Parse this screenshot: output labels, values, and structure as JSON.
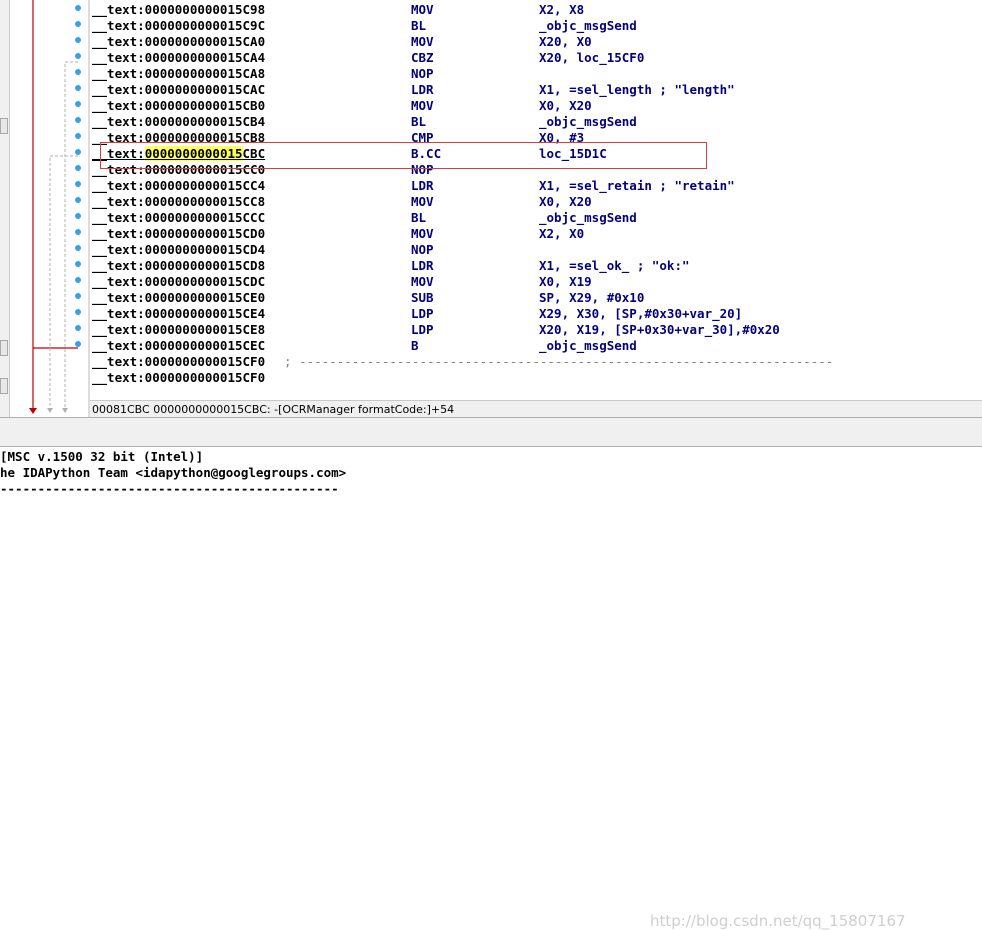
{
  "listing": {
    "rows": [
      {
        "addr": "__text:0000000000015C98",
        "mn": "MOV",
        "ops": "X2, X8"
      },
      {
        "addr": "__text:0000000000015C9C",
        "mn": "BL",
        "ops": "_objc_msgSend"
      },
      {
        "addr": "__text:0000000000015CA0",
        "mn": "MOV",
        "ops": "X20, X0"
      },
      {
        "addr": "__text:0000000000015CA4",
        "mn": "CBZ",
        "ops": "X20, loc_15CF0"
      },
      {
        "addr": "__text:0000000000015CA8",
        "mn": "NOP",
        "ops": ""
      },
      {
        "addr": "__text:0000000000015CAC",
        "mn": "LDR",
        "ops": "X1, =sel_length ; \"length\""
      },
      {
        "addr": "__text:0000000000015CB0",
        "mn": "MOV",
        "ops": "X0, X20"
      },
      {
        "addr": "__text:0000000000015CB4",
        "mn": "BL",
        "ops": "_objc_msgSend"
      },
      {
        "addr": "__text:0000000000015CB8",
        "mn": "CMP",
        "ops": "X0, #3"
      },
      {
        "addr": "__text:0000000000015CBC",
        "mn": "B.CC",
        "ops": "loc_15D1C"
      },
      {
        "addr": "__text:0000000000015CC0",
        "mn": "NOP",
        "ops": ""
      },
      {
        "addr": "__text:0000000000015CC4",
        "mn": "LDR",
        "ops": "X1, =sel_retain ; \"retain\""
      },
      {
        "addr": "__text:0000000000015CC8",
        "mn": "MOV",
        "ops": "X0, X20"
      },
      {
        "addr": "__text:0000000000015CCC",
        "mn": "BL",
        "ops": "_objc_msgSend"
      },
      {
        "addr": "__text:0000000000015CD0",
        "mn": "MOV",
        "ops": "X2, X0"
      },
      {
        "addr": "__text:0000000000015CD4",
        "mn": "NOP",
        "ops": ""
      },
      {
        "addr": "__text:0000000000015CD8",
        "mn": "LDR",
        "ops": "X1, =sel_ok_ ; \"ok:\""
      },
      {
        "addr": "__text:0000000000015CDC",
        "mn": "MOV",
        "ops": "X0, X19"
      },
      {
        "addr": "__text:0000000000015CE0",
        "mn": "SUB",
        "ops": "SP, X29, #0x10"
      },
      {
        "addr": "__text:0000000000015CE4",
        "mn": "LDP",
        "ops": "X29, X30, [SP,#0x30+var_20]"
      },
      {
        "addr": "__text:0000000000015CE8",
        "mn": "LDP",
        "ops": "X20, X19, [SP+0x30+var_30],#0x20"
      },
      {
        "addr": "__text:0000000000015CEC",
        "mn": "B",
        "ops": "_objc_msgSend"
      },
      {
        "addr": "__text:0000000000015CF0",
        "mn": "",
        "ops": "",
        "comment": "; -----------------------------------------------------------------------"
      },
      {
        "addr": "__text:0000000000015CF0",
        "mn": "",
        "ops": ""
      }
    ],
    "selected_row": 9,
    "selected_prefix": "__text:",
    "selected_highlight": "0000000000015",
    "selected_rest": "CBC"
  },
  "statusbar": {
    "text": "00081CBC 0000000000015CBC: -[OCRManager formatCode:]+54"
  },
  "output": {
    "lines": [
      "[MSC v.1500 32 bit (Intel)]",
      "he IDAPython Team <idapython@googlegroups.com>",
      "---------------------------------------------"
    ]
  },
  "watermark": "http://blog.csdn.net/qq_15807167",
  "colors": {
    "mnemonic": "#000080",
    "highlight": "#ffff5a",
    "selection_box": "#d04040",
    "flow_arrow": "#c00000",
    "breakpoint_dot": "#3aa0e8"
  }
}
